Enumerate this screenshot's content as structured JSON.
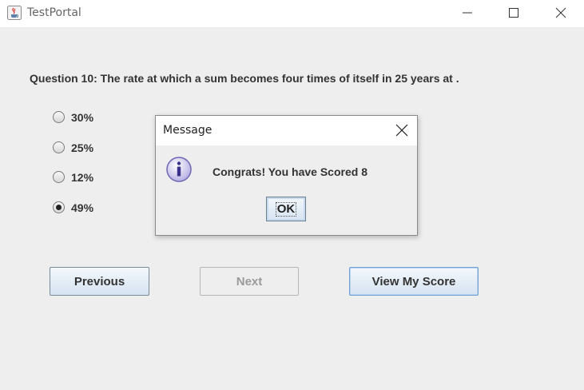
{
  "window": {
    "title": "TestPortal",
    "icon": "java-cup-icon"
  },
  "question": {
    "text": "Question 10: The rate at which a sum becomes four times of itself in 25 years at ."
  },
  "options": [
    {
      "label": "30%",
      "selected": false
    },
    {
      "label": "25%",
      "selected": false
    },
    {
      "label": "12%",
      "selected": false
    },
    {
      "label": "49%",
      "selected": true
    }
  ],
  "buttons": {
    "previous": "Previous",
    "next": "Next",
    "next_enabled": false,
    "view_score": "View My Score"
  },
  "dialog": {
    "title": "Message",
    "icon": "info-icon",
    "message": "Congrats! You have Scored  8",
    "ok_label": "OK"
  }
}
